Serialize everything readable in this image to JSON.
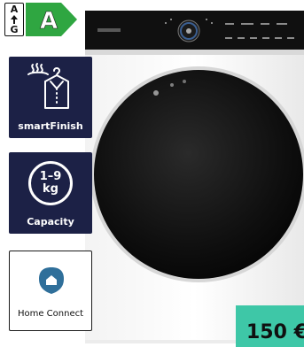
{
  "energy_label": {
    "scale_top": "A",
    "scale_bottom": "G",
    "class": "A",
    "badge_color": "#2fa641"
  },
  "features": [
    {
      "label": "smartFinish",
      "icon": "shirt-steam-icon"
    },
    {
      "label": "Capacity",
      "icon": "weight-capacity-icon",
      "value": "1–9",
      "unit": "kg"
    },
    {
      "label": "Home Connect",
      "icon": "home-connect-icon",
      "icon_color": "#2f6f9a"
    }
  ],
  "price": {
    "text": "150 €",
    "background": "#3ec7a7"
  }
}
